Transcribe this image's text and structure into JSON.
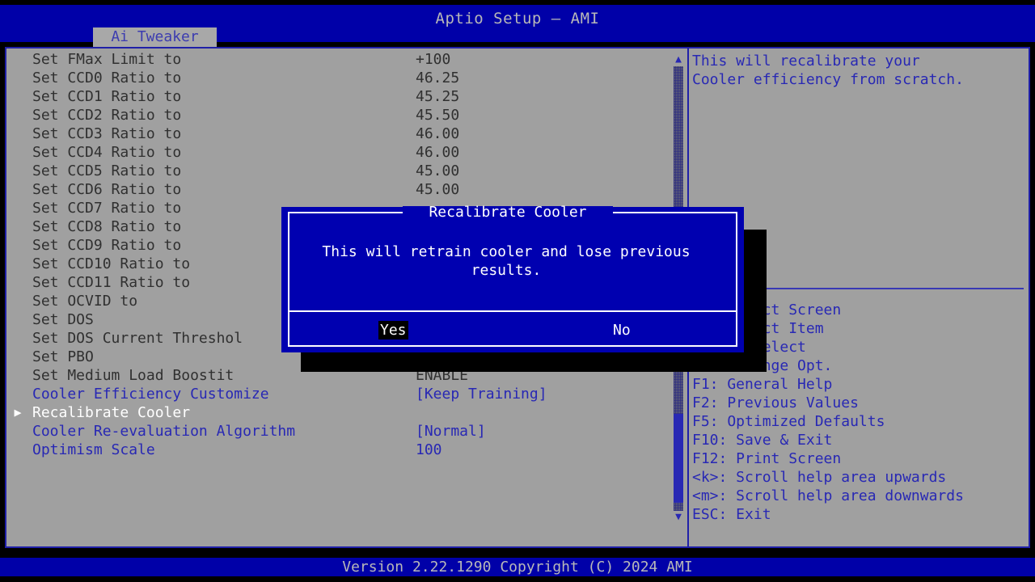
{
  "header": {
    "title": "Aptio Setup – AMI",
    "tab": "Ai Tweaker"
  },
  "settings": [
    {
      "marker": "",
      "label": "Set FMax Limit to",
      "value": "+100",
      "label_color": "dim",
      "value_color": "dim"
    },
    {
      "marker": "",
      "label": "Set CCD0 Ratio to",
      "value": "46.25",
      "label_color": "dim",
      "value_color": "dim"
    },
    {
      "marker": "",
      "label": "Set CCD1 Ratio to",
      "value": "45.25",
      "label_color": "dim",
      "value_color": "dim"
    },
    {
      "marker": "",
      "label": "Set CCD2 Ratio to",
      "value": "45.50",
      "label_color": "dim",
      "value_color": "dim"
    },
    {
      "marker": "",
      "label": "Set CCD3 Ratio to",
      "value": "46.00",
      "label_color": "dim",
      "value_color": "dim"
    },
    {
      "marker": "",
      "label": "Set CCD4 Ratio to",
      "value": "46.00",
      "label_color": "dim",
      "value_color": "dim"
    },
    {
      "marker": "",
      "label": "Set CCD5 Ratio to",
      "value": "45.00",
      "label_color": "dim",
      "value_color": "dim"
    },
    {
      "marker": "",
      "label": "Set CCD6 Ratio to",
      "value": "45.00",
      "label_color": "dim",
      "value_color": "dim"
    },
    {
      "marker": "",
      "label": "Set CCD7 Ratio to",
      "value": "",
      "label_color": "dim",
      "value_color": "dim"
    },
    {
      "marker": "",
      "label": "Set CCD8 Ratio to",
      "value": "",
      "label_color": "dim",
      "value_color": "dim"
    },
    {
      "marker": "",
      "label": "Set CCD9 Ratio to",
      "value": "",
      "label_color": "dim",
      "value_color": "dim"
    },
    {
      "marker": "",
      "label": "Set CCD10 Ratio to",
      "value": "",
      "label_color": "dim",
      "value_color": "dim"
    },
    {
      "marker": "",
      "label": "Set CCD11 Ratio to",
      "value": "",
      "label_color": "dim",
      "value_color": "dim"
    },
    {
      "marker": "",
      "label": "Set OCVID to",
      "value": "",
      "label_color": "dim",
      "value_color": "dim"
    },
    {
      "marker": "",
      "label": "Set DOS",
      "value": "",
      "label_color": "dim",
      "value_color": "dim"
    },
    {
      "marker": "",
      "label": "Set DOS Current Threshol",
      "value": "",
      "label_color": "dim",
      "value_color": "dim"
    },
    {
      "marker": "",
      "label": "Set PBO",
      "value": "",
      "label_color": "dim",
      "value_color": "dim"
    },
    {
      "marker": "",
      "label": "Set Medium Load Boostit",
      "value": "ENABLE",
      "label_color": "dim",
      "value_color": "dim"
    },
    {
      "marker": "",
      "label": "Cooler Efficiency Customize",
      "value": "[Keep Training]",
      "label_color": "blue",
      "value_color": "blue"
    },
    {
      "marker": "▶",
      "label": "Recalibrate Cooler",
      "value": "",
      "label_color": "white",
      "value_color": "white"
    },
    {
      "marker": "",
      "label": "Cooler Re-evaluation Algorithm",
      "value": "[Normal]",
      "label_color": "blue",
      "value_color": "blue"
    },
    {
      "marker": "",
      "label": "Optimism Scale",
      "value": "100",
      "label_color": "blue",
      "value_color": "blue"
    }
  ],
  "scrollbar": {
    "up_arrow": "▲",
    "down_arrow": "▼"
  },
  "help": {
    "text": "This will recalibrate your\nCooler efficiency from scratch.",
    "keys": "→←: Select Screen\n↑↓: Select Item\nEnter: Select\n+/-: Change Opt.\nF1: General Help\nF2: Previous Values\nF5: Optimized Defaults\nF10: Save & Exit\nF12: Print Screen\n<k>: Scroll help area upwards\n<m>: Scroll help area downwards\nESC: Exit"
  },
  "dialog": {
    "title": "Recalibrate Cooler",
    "message": "This will retrain cooler and lose previous\nresults.",
    "yes_label": "Yes",
    "no_label": "No"
  },
  "footer": {
    "version": "Version 2.22.1290 Copyright (C) 2024 AMI"
  },
  "colors": {
    "header_blue": "#0000a8",
    "body_gray": "#a0a0a0",
    "accent_blue": "#2828b4",
    "dialog_blue": "#0000b0",
    "selected_white": "#ffffff"
  }
}
